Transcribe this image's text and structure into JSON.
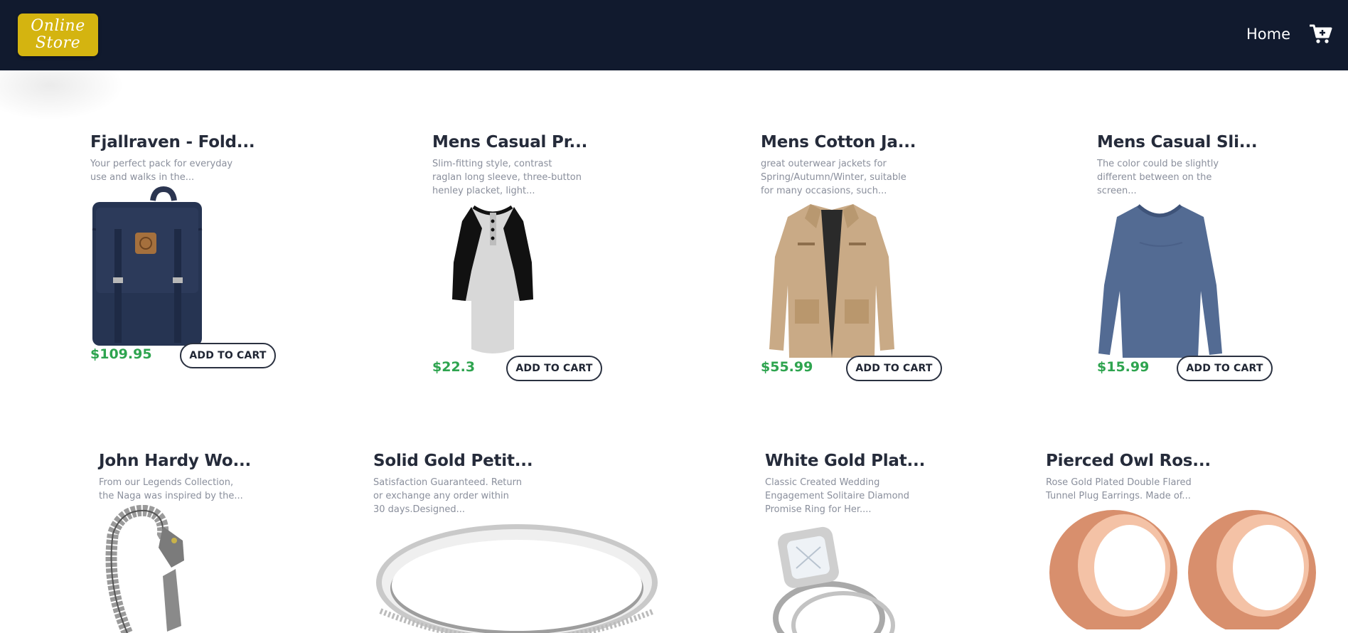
{
  "brand": {
    "logo_line1": "Online",
    "logo_line2": "Store"
  },
  "nav": {
    "home_label": "Home",
    "cart_icon": "cart-plus-icon"
  },
  "colors": {
    "navbar": "#111a2e",
    "logo": "#d4b410",
    "price": "#2ea44f"
  },
  "products": [
    {
      "title": "Fjallraven - Fold...",
      "description": "Your perfect pack for everyday use and walks in the...",
      "price": "$109.95",
      "button": "ADD TO CART",
      "image": "backpack-image"
    },
    {
      "title": "Mens Casual Pr...",
      "description": "Slim-fitting style, contrast raglan long sleeve, three-button henley placket, light...",
      "price": "$22.3",
      "button": "ADD TO CART",
      "image": "raglan-shirt-image"
    },
    {
      "title": "Mens Cotton Ja...",
      "description": "great outerwear jackets for Spring/Autumn/Winter, suitable for many occasions, such...",
      "price": "$55.99",
      "button": "ADD TO CART",
      "image": "cotton-jacket-image"
    },
    {
      "title": "Mens Casual Sli...",
      "description": "The color could be slightly different between on the screen...",
      "price": "$15.99",
      "button": "ADD TO CART",
      "image": "long-sleeve-tee-image"
    },
    {
      "title": "John Hardy Wo...",
      "description": "From our Legends Collection, the Naga was inspired by the...",
      "image": "dragon-bracelet-image"
    },
    {
      "title": "Solid Gold Petit...",
      "description": "Satisfaction Guaranteed. Return or exchange any order within 30 days.Designed...",
      "image": "silver-ring-image"
    },
    {
      "title": "White Gold Plat...",
      "description": "Classic Created Wedding Engagement Solitaire Diamond Promise Ring for Her....",
      "image": "diamond-ring-image"
    },
    {
      "title": "Pierced Owl Ros...",
      "description": "Rose Gold Plated Double Flared Tunnel Plug Earrings. Made of...",
      "image": "rose-gold-plugs-image"
    }
  ]
}
